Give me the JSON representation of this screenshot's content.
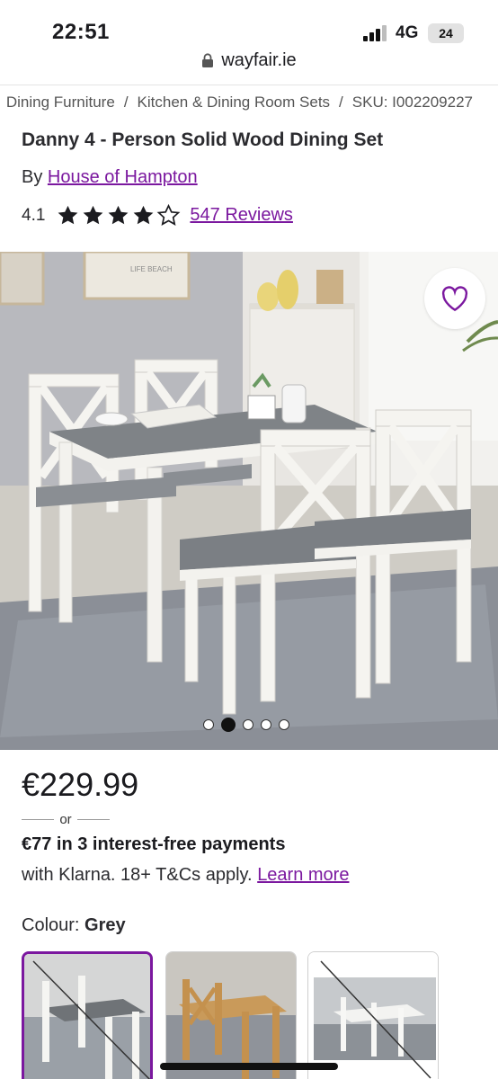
{
  "status_bar": {
    "time": "22:51",
    "network": "4G",
    "battery": "24"
  },
  "browser": {
    "url": "wayfair.ie",
    "icons": [
      "lock-icon"
    ]
  },
  "breadcrumb": {
    "items": [
      "Dining Furniture",
      "Kitchen & Dining Room Sets",
      "SKU: I002209227"
    ],
    "separator": "/"
  },
  "product": {
    "title": "Danny 4 - Person Solid Wood Dining Set",
    "by_label": "By",
    "brand": "House of Hampton",
    "rating": "4.1",
    "stars_filled": 4,
    "stars_total": 5,
    "reviews": "547 Reviews"
  },
  "gallery": {
    "image_text": "LIFE BEACH",
    "total_images": 5,
    "active_index": 1,
    "favorite_icon": "heart-outline-icon"
  },
  "pricing": {
    "price": "€229.99",
    "or": "or",
    "installments": "€77 in 3 interest-free payments",
    "klarna_text": "with Klarna. 18+ T&Cs apply.",
    "learn_more": "Learn more"
  },
  "colour": {
    "label": "Colour:",
    "selected": "Grey",
    "options": [
      "Grey",
      "Natural",
      "White"
    ],
    "unavailable": [
      true,
      false,
      true
    ]
  },
  "colors": {
    "accent": "#7b189f",
    "text": "#1b1b1f",
    "star": "#1b1b1f"
  }
}
